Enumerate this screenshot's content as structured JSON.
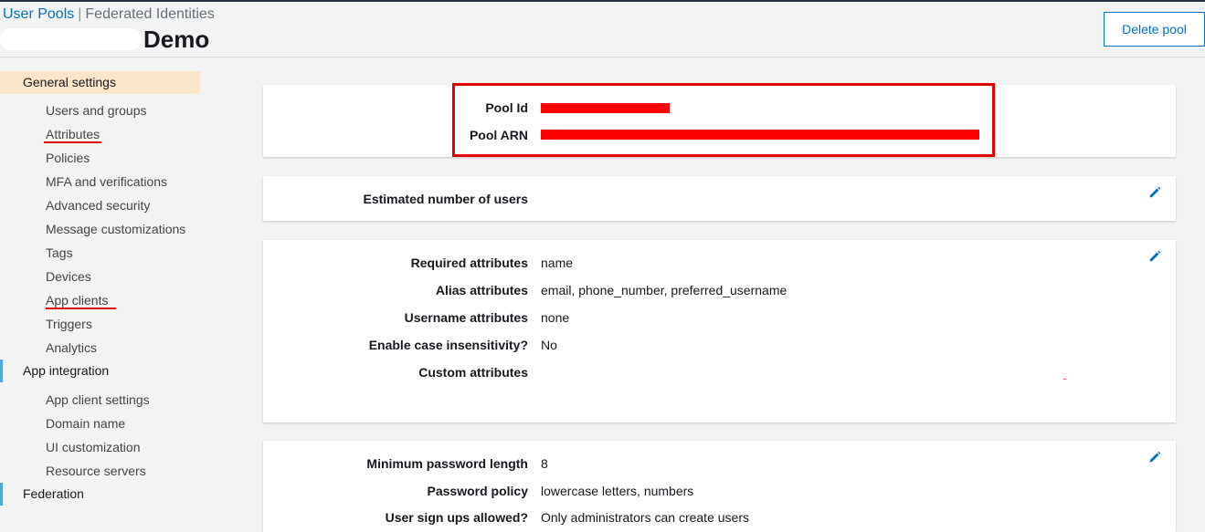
{
  "header": {
    "breadcrumbs": [
      "User Pools",
      "Federated Identities"
    ],
    "pool_title": "Demo",
    "delete_button": "Delete pool"
  },
  "sidebar": {
    "general_settings": "General settings",
    "general_items": [
      "Users and groups",
      "Attributes",
      "Policies",
      "MFA and verifications",
      "Advanced security",
      "Message customizations",
      "Tags",
      "Devices",
      "App clients",
      "Triggers",
      "Analytics"
    ],
    "app_integration": "App integration",
    "app_items": [
      "App client settings",
      "Domain name",
      "UI customization",
      "Resource servers"
    ],
    "federation": "Federation"
  },
  "pool_info": {
    "pool_id_label": "Pool Id",
    "pool_arn_label": "Pool ARN"
  },
  "users_card": {
    "estimated_label": "Estimated number of users"
  },
  "attributes_card": {
    "rows": [
      {
        "label": "Required attributes",
        "value": "name"
      },
      {
        "label": "Alias attributes",
        "value": "email, phone_number, preferred_username"
      },
      {
        "label": "Username attributes",
        "value": "none"
      },
      {
        "label": "Enable case insensitivity?",
        "value": "No"
      },
      {
        "label": "Custom attributes",
        "value": ""
      }
    ]
  },
  "policy_card": {
    "rows": [
      {
        "label": "Minimum password length",
        "value": "8"
      },
      {
        "label": "Password policy",
        "value": "lowercase letters, numbers"
      },
      {
        "label": "User sign ups allowed?",
        "value": "Only administrators can create users"
      }
    ]
  },
  "colors": {
    "link": "#0073bb",
    "active_nav": "#fbe5c8",
    "annotation_red": "#e00000"
  }
}
